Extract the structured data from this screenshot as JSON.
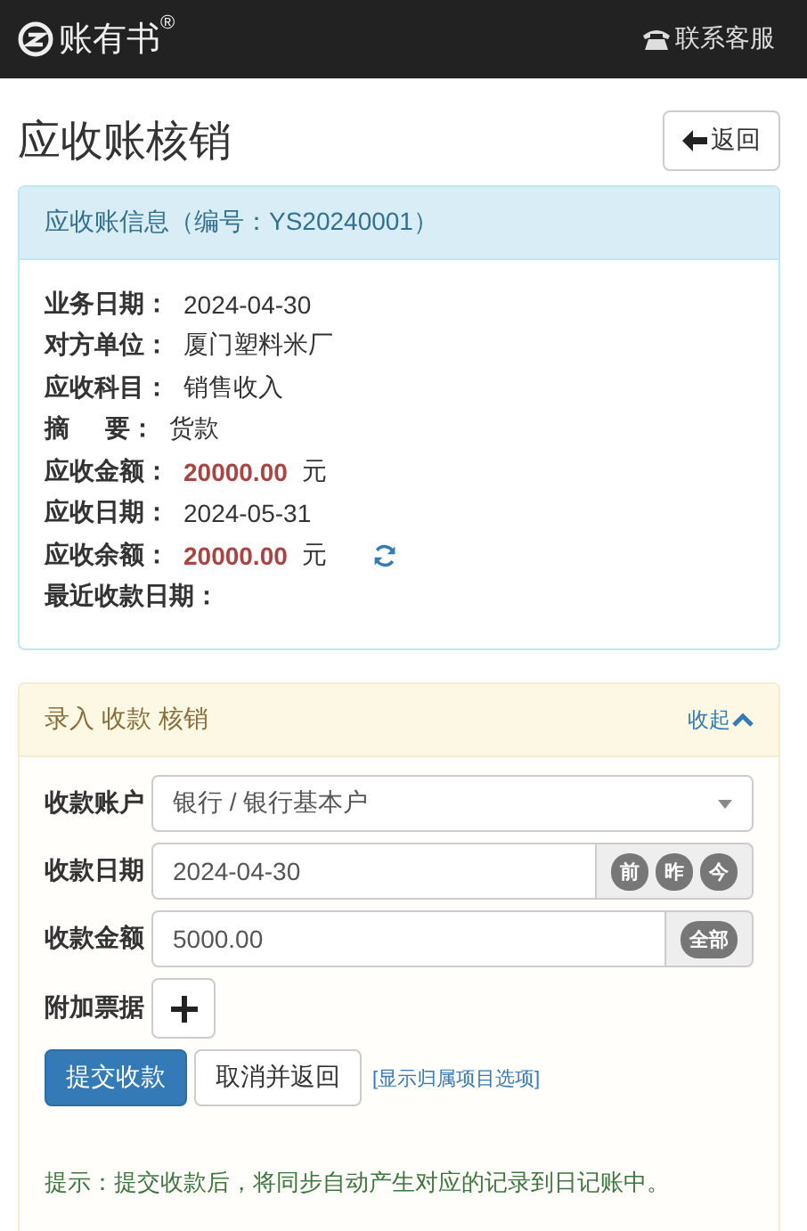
{
  "navbar": {
    "brand": "账有书",
    "brand_mark": "®",
    "support": "联系客服"
  },
  "page": {
    "title": "应收账核销",
    "back_button": "返回"
  },
  "info_panel": {
    "heading": "应收账信息（编号：YS20240001）",
    "rows": [
      {
        "kind": "text",
        "label": "业务日期：",
        "value": "2024-04-30"
      },
      {
        "kind": "text",
        "label": "对方单位：",
        "value": "厦门塑料米厂"
      },
      {
        "kind": "text",
        "label": "应收科目：",
        "value": "销售收入"
      },
      {
        "kind": "spaced",
        "label_start": "摘",
        "label_end": "要：",
        "value": "货款"
      },
      {
        "kind": "amount",
        "label": "应收金额：",
        "value": "20000.00",
        "unit": "元",
        "refresh": false
      },
      {
        "kind": "text",
        "label": "应收日期：",
        "value": "2024-05-31"
      },
      {
        "kind": "amount",
        "label": "应收余额：",
        "value": "20000.00",
        "unit": "元",
        "refresh": true
      },
      {
        "kind": "empty",
        "label": "最近收款日期："
      }
    ]
  },
  "entry_panel": {
    "heading": "录入 收款 核销",
    "toggle": "收起",
    "expanded": true,
    "fields": [
      {
        "kind": "select",
        "label": "收款账户",
        "value": "银行 / 银行基本户"
      },
      {
        "kind": "date",
        "label": "收款日期",
        "value": "2024-04-30",
        "quick": [
          "前",
          "昨",
          "今"
        ]
      },
      {
        "kind": "amount",
        "label": "收款金额",
        "value": "5000.00",
        "quick": [
          "全部"
        ]
      },
      {
        "kind": "attach",
        "label": "附加票据"
      }
    ],
    "submit": "提交收款",
    "cancel": "取消并返回",
    "link": "[显示归属项目选项]",
    "hint": "提示：提交收款后，将同步自动产生对应的记录到日记账中。"
  }
}
